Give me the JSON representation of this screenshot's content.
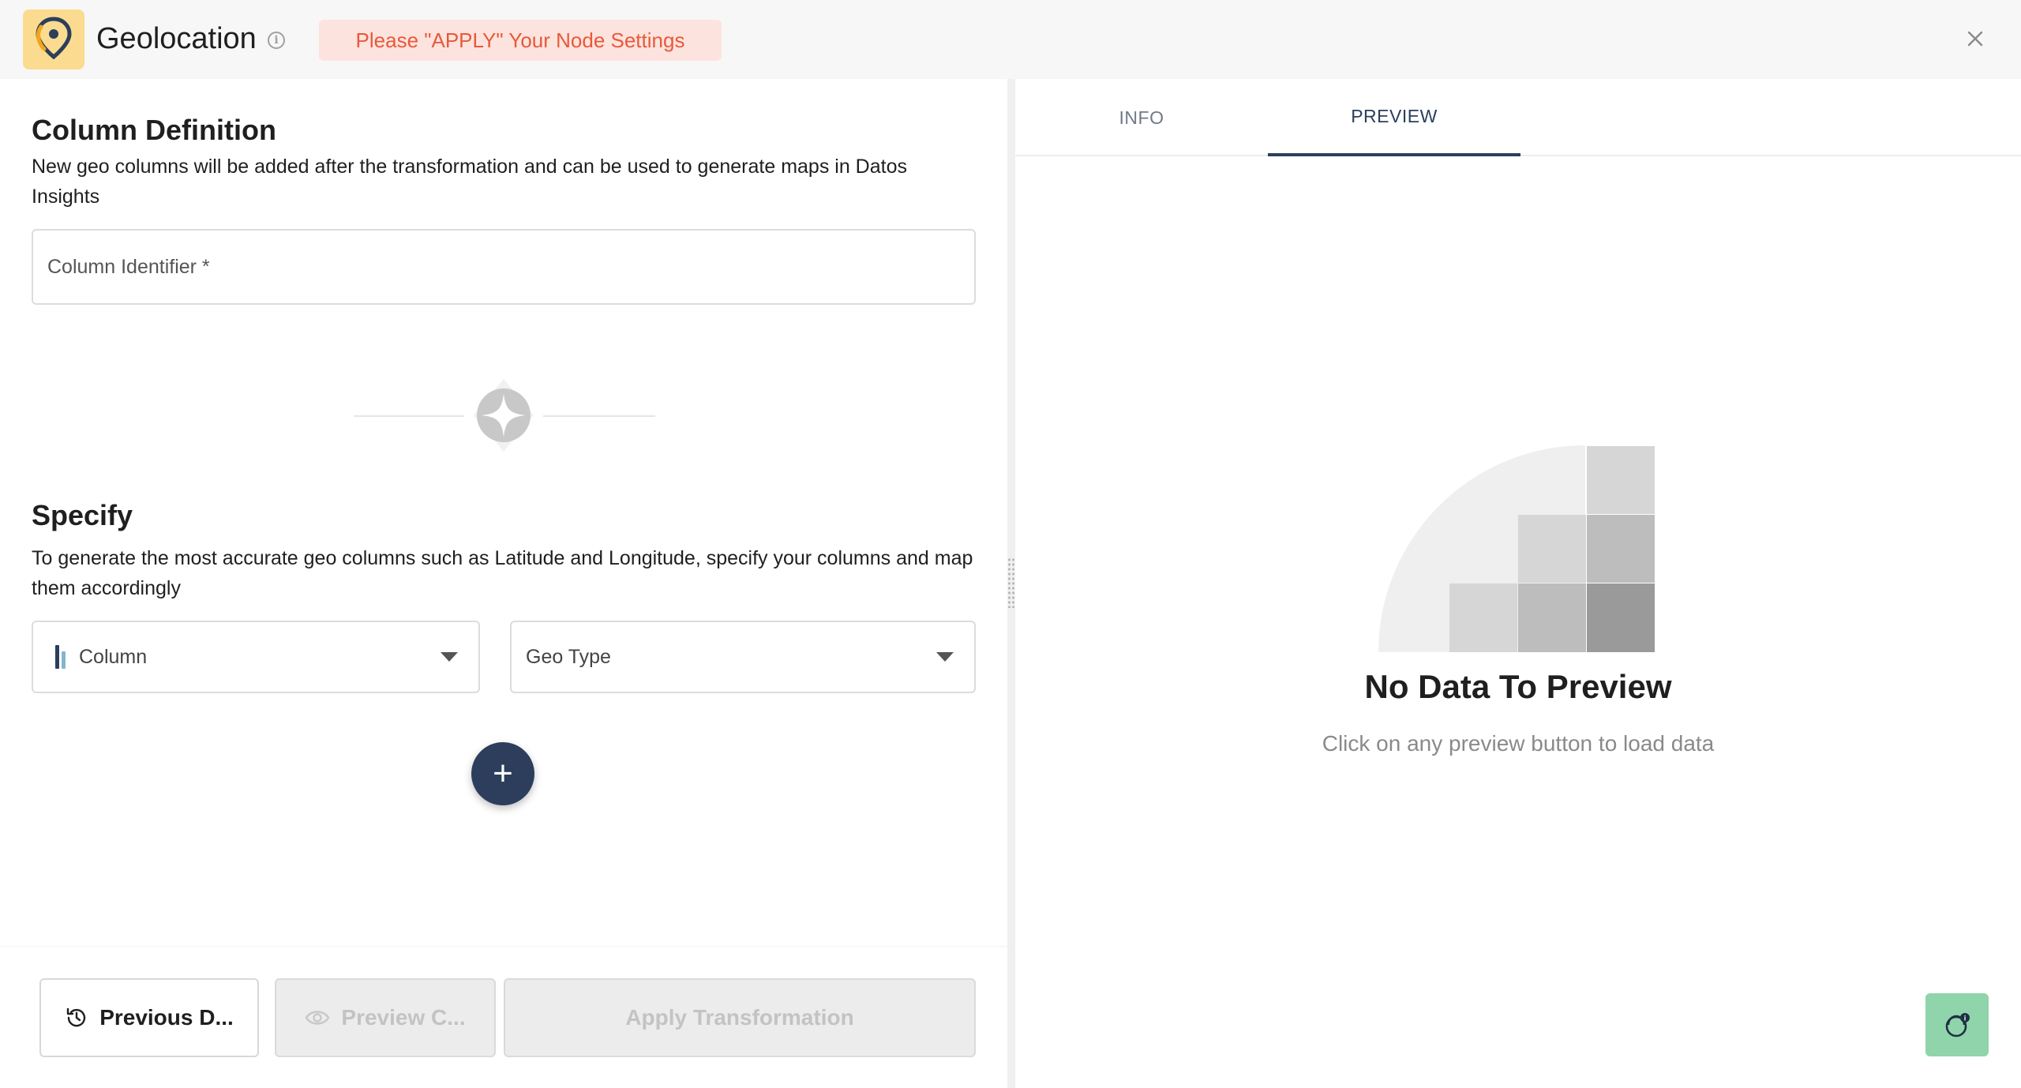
{
  "header": {
    "title": "Geolocation",
    "warning": "Please \"APPLY\" Your Node Settings",
    "icons": {
      "logo": "location-pin-icon",
      "info": "info-icon",
      "close": "close-icon"
    }
  },
  "column_definition": {
    "title": "Column Definition",
    "description": "New geo columns will be added after the transformation and can be used to generate maps in Datos Insights",
    "identifier_placeholder": "Column Identifier *"
  },
  "specify": {
    "title": "Specify",
    "description": "To generate the most accurate geo columns such as Latitude and Longitude, specify your columns and map them accordingly",
    "column_select": "Column",
    "geo_type_select": "Geo Type",
    "add_icon": "plus-icon"
  },
  "footer": {
    "previous_label": "Previous D...",
    "preview_label": "Preview C...",
    "apply_label": "Apply Transformation"
  },
  "right_panel": {
    "tabs": [
      "INFO",
      "PREVIEW"
    ],
    "active_tab": "PREVIEW",
    "empty_title": "No Data To Preview",
    "empty_subtitle": "Click on any preview button to load data"
  },
  "colors": {
    "accent": "#2c3e5c",
    "warning_bg": "#fde3de",
    "warning_text": "#e8593b",
    "logo_bg": "#fbdb8f",
    "help_bg": "#8fd4aa"
  }
}
